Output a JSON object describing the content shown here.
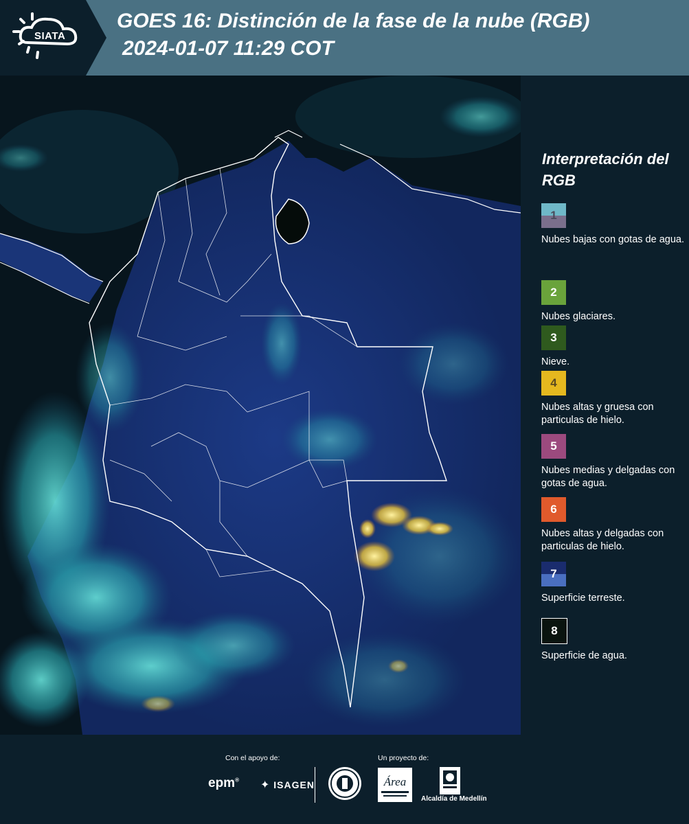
{
  "header": {
    "logo_text": "SIATA",
    "title_line1": "GOES 16: Distinción de la fase de la nube (RGB)",
    "title_line2": "2024-01-07 11:29 COT"
  },
  "legend": {
    "title": "Interpretación del RGB",
    "items": [
      {
        "number": "1",
        "label": "Nubes bajas con gotas de agua.",
        "colors": [
          "#6fb8c8",
          "#7a6f8c"
        ],
        "num_color": "#4a4a5a"
      },
      {
        "number": "2",
        "label": "Nubes glaciares.",
        "colors": [
          "#6aa33b"
        ],
        "num_color": "#ffffff"
      },
      {
        "number": "3",
        "label": "Nieve.",
        "colors": [
          "#2f5a1e"
        ],
        "num_color": "#ffffff"
      },
      {
        "number": "4",
        "label": "Nubes altas y gruesa con particulas de hielo.",
        "colors": [
          "#e5b81f"
        ],
        "num_color": "#5a4a20"
      },
      {
        "number": "5",
        "label": "Nubes medias y delgadas con gotas de agua.",
        "colors": [
          "#9c4a7e"
        ],
        "num_color": "#ffffff"
      },
      {
        "number": "6",
        "label": "Nubes altas y delgadas con particulas de hielo.",
        "colors": [
          "#e05a2c"
        ],
        "num_color": "#ffffff"
      },
      {
        "number": "7",
        "label": "Superficie terreste.",
        "colors": [
          "#1a2c6e",
          "#4a6fc0"
        ],
        "num_color": "#ffffff"
      },
      {
        "number": "8",
        "label": "Superficie de agua.",
        "colors": [
          "#0a140f"
        ],
        "num_color": "#ffffff"
      }
    ]
  },
  "footer": {
    "support_label": "Con el apoyo de:",
    "project_label": "Un proyecto de:",
    "epm": "epm",
    "isagen": "ISAGEN",
    "alcaldia": "Alcaldía de Medellín",
    "area_logo_text": "Área"
  }
}
